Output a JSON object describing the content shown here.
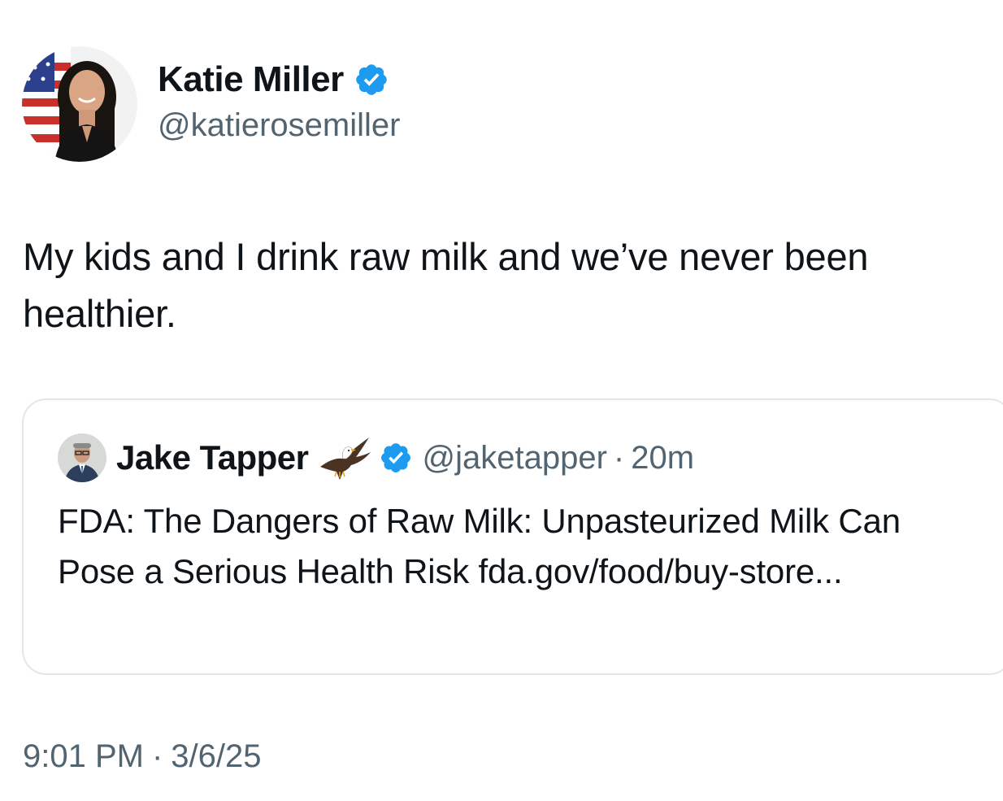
{
  "author": {
    "display_name": "Katie Miller",
    "handle": "@katierosemiller",
    "verified": true,
    "avatar_icon": "profile-photo-avatar"
  },
  "tweet": {
    "text": "My kids and I drink raw milk and we’ve never been healthier."
  },
  "quoted_tweet": {
    "author_name": "Jake Tapper",
    "emoji_icon": "eagle-icon",
    "verified": true,
    "handle": "@jaketapper",
    "separator": "·",
    "time_ago": "20m",
    "text": "FDA: The Dangers of Raw Milk: Unpasteurized Milk Can Pose a Serious Health Risk  fda.gov/food/buy-store..."
  },
  "timestamp": {
    "time": "9:01 PM",
    "separator": "·",
    "date": "3/6/25"
  },
  "colors": {
    "text_primary": "#0f1419",
    "text_secondary": "#536471",
    "verified_blue": "#1d9bf0",
    "border": "#e1e8ed"
  }
}
